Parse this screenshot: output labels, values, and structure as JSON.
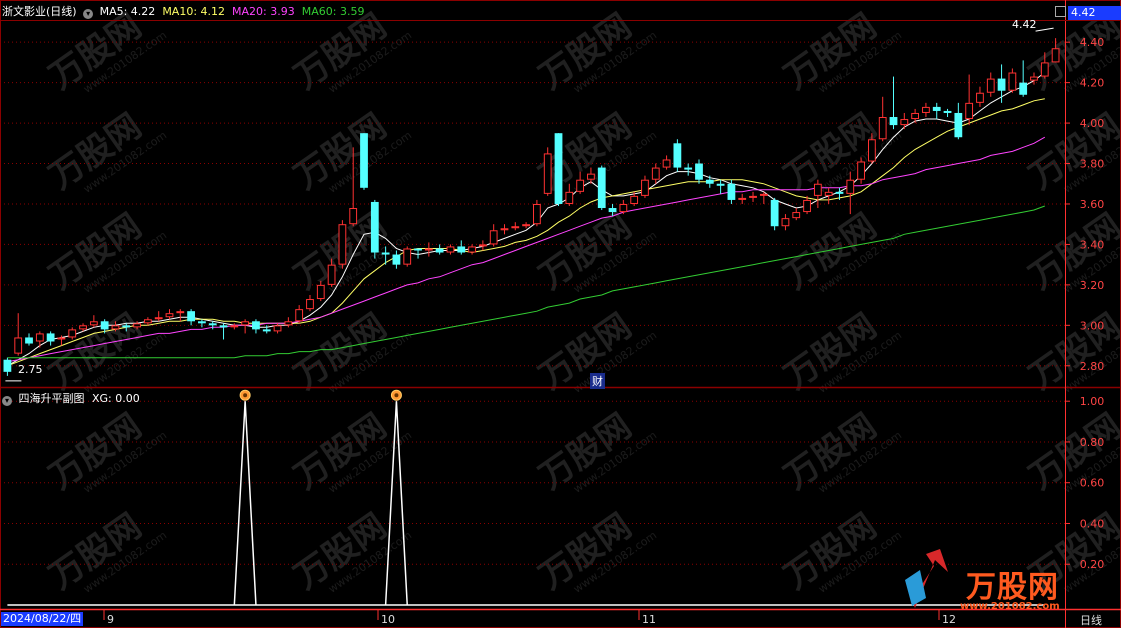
{
  "main_header": {
    "title": "浙文影业(日线)",
    "ma5_label": "MA5: 4.22",
    "ma10_label": "MA10: 4.12",
    "ma20_label": "MA20: 3.93",
    "ma60_label": "MA60: 3.59"
  },
  "sub_header": {
    "title": "四海升平副图",
    "xg_label": "XG: 0.00"
  },
  "price_axis": {
    "current_price_badge": "4.42",
    "ticks": [
      "4.40",
      "4.20",
      "4.00",
      "3.80",
      "3.60",
      "3.40",
      "3.20",
      "3.00",
      "2.80"
    ]
  },
  "indicator_axis": {
    "ticks": [
      "1.00",
      "0.80",
      "0.60",
      "0.40",
      "0.20"
    ]
  },
  "date_axis": {
    "start_date": "2024/08/22/四",
    "months": [
      "9",
      "10",
      "11",
      "12"
    ],
    "period_label": "日线"
  },
  "annotations": {
    "high_label": "4.42",
    "low_label": "2.75",
    "finance_marker": "财"
  },
  "watermark": {
    "brand": "万股网",
    "site": "www.201082.com"
  },
  "colors": {
    "up": "#ff3232",
    "down": "#54ffff",
    "ma5": "#ffffff",
    "ma10": "#ffff66",
    "ma20": "#ff44ff",
    "ma60": "#33cc33",
    "grid": "#8b0000",
    "axis_text": "#ff4444"
  },
  "chart_data": [
    {
      "type": "candlestick",
      "title": "浙文影业(日线)",
      "ylim": [
        2.7,
        4.48
      ],
      "series_note": "daily OHLC (open, close, high, low)",
      "candles": [
        [
          2.83,
          2.77,
          2.84,
          2.75
        ],
        [
          2.86,
          2.94,
          3.06,
          2.85
        ],
        [
          2.94,
          2.91,
          2.96,
          2.9
        ],
        [
          2.92,
          2.96,
          2.97,
          2.89
        ],
        [
          2.96,
          2.92,
          2.97,
          2.9
        ],
        [
          2.93,
          2.94,
          2.95,
          2.9
        ],
        [
          2.94,
          2.98,
          2.99,
          2.93
        ],
        [
          2.98,
          3.0,
          3.01,
          2.97
        ],
        [
          3.0,
          3.02,
          3.05,
          2.99
        ],
        [
          3.02,
          2.98,
          3.03,
          2.96
        ],
        [
          2.98,
          3.0,
          3.02,
          2.97
        ],
        [
          3.0,
          2.99,
          3.01,
          2.97
        ],
        [
          2.99,
          3.01,
          3.02,
          2.98
        ],
        [
          3.01,
          3.03,
          3.04,
          3.0
        ],
        [
          3.03,
          3.04,
          3.07,
          3.02
        ],
        [
          3.04,
          3.06,
          3.08,
          3.03
        ],
        [
          3.06,
          3.07,
          3.08,
          3.02
        ],
        [
          3.07,
          3.02,
          3.08,
          3.0
        ],
        [
          3.02,
          3.01,
          3.03,
          2.99
        ],
        [
          3.01,
          3.0,
          3.02,
          2.98
        ],
        [
          3.0,
          2.99,
          3.01,
          2.93
        ],
        [
          2.99,
          3.0,
          3.01,
          2.98
        ],
        [
          3.0,
          3.02,
          3.03,
          2.96
        ],
        [
          3.02,
          2.98,
          3.03,
          2.96
        ],
        [
          2.98,
          2.97,
          3.0,
          2.96
        ],
        [
          2.97,
          3.0,
          3.01,
          2.96
        ],
        [
          3.0,
          3.02,
          3.04,
          2.99
        ],
        [
          3.02,
          3.08,
          3.1,
          3.01
        ],
        [
          3.08,
          3.13,
          3.15,
          3.07
        ],
        [
          3.13,
          3.2,
          3.22,
          3.12
        ],
        [
          3.2,
          3.3,
          3.33,
          3.19
        ],
        [
          3.3,
          3.5,
          3.52,
          3.28
        ],
        [
          3.5,
          3.58,
          3.88,
          3.49
        ],
        [
          3.95,
          3.68,
          3.95,
          3.67
        ],
        [
          3.61,
          3.36,
          3.62,
          3.33
        ],
        [
          3.36,
          3.35,
          3.39,
          3.3
        ],
        [
          3.35,
          3.3,
          3.37,
          3.28
        ],
        [
          3.3,
          3.38,
          3.39,
          3.29
        ],
        [
          3.38,
          3.37,
          3.38,
          3.33
        ],
        [
          3.37,
          3.38,
          3.41,
          3.34
        ],
        [
          3.38,
          3.36,
          3.4,
          3.35
        ],
        [
          3.36,
          3.39,
          3.4,
          3.35
        ],
        [
          3.39,
          3.36,
          3.42,
          3.35
        ],
        [
          3.36,
          3.39,
          3.4,
          3.35
        ],
        [
          3.39,
          3.4,
          3.42,
          3.37
        ],
        [
          3.4,
          3.47,
          3.5,
          3.39
        ],
        [
          3.47,
          3.48,
          3.5,
          3.45
        ],
        [
          3.48,
          3.49,
          3.51,
          3.47
        ],
        [
          3.49,
          3.5,
          3.51,
          3.48
        ],
        [
          3.5,
          3.6,
          3.62,
          3.49
        ],
        [
          3.65,
          3.85,
          3.88,
          3.64
        ],
        [
          3.95,
          3.6,
          3.95,
          3.59
        ],
        [
          3.6,
          3.66,
          3.7,
          3.59
        ],
        [
          3.66,
          3.72,
          3.76,
          3.65
        ],
        [
          3.72,
          3.75,
          3.78,
          3.7
        ],
        [
          3.78,
          3.58,
          3.79,
          3.57
        ],
        [
          3.58,
          3.56,
          3.6,
          3.54
        ],
        [
          3.56,
          3.6,
          3.62,
          3.55
        ],
        [
          3.6,
          3.64,
          3.66,
          3.59
        ],
        [
          3.64,
          3.72,
          3.74,
          3.63
        ],
        [
          3.72,
          3.78,
          3.8,
          3.7
        ],
        [
          3.78,
          3.82,
          3.84,
          3.77
        ],
        [
          3.9,
          3.78,
          3.92,
          3.76
        ],
        [
          3.78,
          3.77,
          3.8,
          3.74
        ],
        [
          3.8,
          3.72,
          3.82,
          3.7
        ],
        [
          3.72,
          3.7,
          3.74,
          3.68
        ],
        [
          3.7,
          3.69,
          3.72,
          3.65
        ],
        [
          3.7,
          3.62,
          3.72,
          3.6
        ],
        [
          3.62,
          3.63,
          3.65,
          3.6
        ],
        [
          3.63,
          3.64,
          3.66,
          3.61
        ],
        [
          3.64,
          3.65,
          3.66,
          3.6
        ],
        [
          3.62,
          3.49,
          3.63,
          3.47
        ],
        [
          3.49,
          3.53,
          3.55,
          3.47
        ],
        [
          3.53,
          3.56,
          3.58,
          3.52
        ],
        [
          3.56,
          3.62,
          3.64,
          3.55
        ],
        [
          3.64,
          3.7,
          3.72,
          3.58
        ],
        [
          3.64,
          3.66,
          3.68,
          3.6
        ],
        [
          3.66,
          3.65,
          3.68,
          3.62
        ],
        [
          3.65,
          3.72,
          3.76,
          3.55
        ],
        [
          3.72,
          3.81,
          3.83,
          3.7
        ],
        [
          3.81,
          3.92,
          3.95,
          3.8
        ],
        [
          3.92,
          4.03,
          4.13,
          3.91
        ],
        [
          4.03,
          3.99,
          4.23,
          3.97
        ],
        [
          3.99,
          4.02,
          4.05,
          3.97
        ],
        [
          4.02,
          4.05,
          4.07,
          4.0
        ],
        [
          4.05,
          4.08,
          4.1,
          4.03
        ],
        [
          4.08,
          4.06,
          4.1,
          4.02
        ],
        [
          4.06,
          4.05,
          4.07,
          4.03
        ],
        [
          4.05,
          3.93,
          4.1,
          3.92
        ],
        [
          4.02,
          4.1,
          4.24,
          3.99
        ],
        [
          4.1,
          4.15,
          4.18,
          4.08
        ],
        [
          4.15,
          4.22,
          4.25,
          4.13
        ],
        [
          4.22,
          4.16,
          4.29,
          4.1
        ],
        [
          4.16,
          4.25,
          4.27,
          4.15
        ],
        [
          4.2,
          4.14,
          4.31,
          4.13
        ],
        [
          4.21,
          4.23,
          4.25,
          4.19
        ],
        [
          4.23,
          4.3,
          4.35,
          4.22
        ],
        [
          4.3,
          4.37,
          4.42,
          4.3
        ]
      ],
      "ma": {
        "MA5": [
          2.8,
          2.83,
          2.86,
          2.9,
          2.93,
          2.94,
          2.95,
          2.97,
          2.99,
          3.0,
          3.0,
          3.01,
          3.01,
          3.02,
          3.02,
          3.03,
          3.04,
          3.04,
          3.03,
          3.02,
          3.01,
          3.0,
          3.0,
          2.99,
          2.99,
          3.0,
          3.0,
          3.02,
          3.05,
          3.09,
          3.15,
          3.24,
          3.35,
          3.45,
          3.46,
          3.43,
          3.38,
          3.36,
          3.35,
          3.36,
          3.37,
          3.37,
          3.37,
          3.38,
          3.39,
          3.41,
          3.43,
          3.45,
          3.47,
          3.51,
          3.58,
          3.6,
          3.63,
          3.68,
          3.71,
          3.67,
          3.64,
          3.64,
          3.65,
          3.66,
          3.7,
          3.74,
          3.76,
          3.76,
          3.75,
          3.73,
          3.72,
          3.7,
          3.69,
          3.68,
          3.66,
          3.62,
          3.6,
          3.58,
          3.59,
          3.62,
          3.64,
          3.66,
          3.69,
          3.74,
          3.8,
          3.87,
          3.93,
          3.98,
          4.01,
          4.02,
          4.02,
          4.01,
          4.0,
          4.02,
          4.06,
          4.1,
          4.13,
          4.16,
          4.18,
          4.21,
          4.25
        ],
        "MA10": [
          2.8,
          2.82,
          2.84,
          2.86,
          2.88,
          2.9,
          2.92,
          2.94,
          2.96,
          2.97,
          2.98,
          2.99,
          3.0,
          3.0,
          3.01,
          3.02,
          3.02,
          3.03,
          3.03,
          3.03,
          3.02,
          3.02,
          3.01,
          3.01,
          3.01,
          3.01,
          3.01,
          3.01,
          3.02,
          3.04,
          3.06,
          3.11,
          3.17,
          3.23,
          3.27,
          3.31,
          3.34,
          3.37,
          3.38,
          3.38,
          3.38,
          3.38,
          3.37,
          3.36,
          3.37,
          3.38,
          3.39,
          3.41,
          3.42,
          3.44,
          3.47,
          3.51,
          3.54,
          3.58,
          3.61,
          3.63,
          3.64,
          3.65,
          3.66,
          3.67,
          3.68,
          3.69,
          3.7,
          3.71,
          3.71,
          3.71,
          3.72,
          3.72,
          3.72,
          3.71,
          3.7,
          3.68,
          3.66,
          3.64,
          3.63,
          3.62,
          3.62,
          3.63,
          3.64,
          3.66,
          3.7,
          3.74,
          3.78,
          3.83,
          3.87,
          3.9,
          3.93,
          3.96,
          3.98,
          4.0,
          4.02,
          4.04,
          4.06,
          4.07,
          4.09,
          4.11,
          4.12
        ],
        "MA20": [
          2.82,
          2.83,
          2.84,
          2.85,
          2.86,
          2.87,
          2.88,
          2.89,
          2.9,
          2.91,
          2.92,
          2.93,
          2.94,
          2.95,
          2.96,
          2.96,
          2.97,
          2.98,
          2.98,
          2.99,
          2.99,
          3.0,
          3.0,
          3.0,
          3.01,
          3.01,
          3.01,
          3.02,
          3.03,
          3.04,
          3.06,
          3.08,
          3.1,
          3.12,
          3.14,
          3.16,
          3.18,
          3.2,
          3.21,
          3.23,
          3.24,
          3.26,
          3.28,
          3.3,
          3.31,
          3.33,
          3.35,
          3.37,
          3.39,
          3.41,
          3.43,
          3.45,
          3.47,
          3.49,
          3.51,
          3.53,
          3.54,
          3.56,
          3.57,
          3.58,
          3.59,
          3.6,
          3.61,
          3.62,
          3.63,
          3.64,
          3.65,
          3.66,
          3.66,
          3.67,
          3.67,
          3.67,
          3.67,
          3.67,
          3.67,
          3.68,
          3.68,
          3.68,
          3.69,
          3.69,
          3.7,
          3.72,
          3.73,
          3.74,
          3.75,
          3.77,
          3.78,
          3.79,
          3.8,
          3.81,
          3.82,
          3.84,
          3.85,
          3.86,
          3.88,
          3.9,
          3.93
        ],
        "MA60": [
          2.84,
          2.84,
          2.84,
          2.84,
          2.84,
          2.84,
          2.84,
          2.84,
          2.84,
          2.84,
          2.84,
          2.84,
          2.84,
          2.84,
          2.84,
          2.84,
          2.84,
          2.84,
          2.84,
          2.84,
          2.84,
          2.84,
          2.85,
          2.85,
          2.85,
          2.86,
          2.86,
          2.87,
          2.87,
          2.88,
          2.88,
          2.89,
          2.9,
          2.91,
          2.92,
          2.93,
          2.94,
          2.95,
          2.96,
          2.97,
          2.98,
          2.99,
          3.0,
          3.01,
          3.02,
          3.03,
          3.04,
          3.05,
          3.06,
          3.07,
          3.09,
          3.1,
          3.11,
          3.13,
          3.14,
          3.15,
          3.17,
          3.18,
          3.19,
          3.2,
          3.21,
          3.22,
          3.23,
          3.24,
          3.25,
          3.26,
          3.27,
          3.28,
          3.29,
          3.3,
          3.31,
          3.32,
          3.33,
          3.34,
          3.35,
          3.36,
          3.37,
          3.38,
          3.39,
          3.4,
          3.41,
          3.42,
          3.43,
          3.45,
          3.46,
          3.47,
          3.48,
          3.49,
          3.5,
          3.51,
          3.52,
          3.53,
          3.54,
          3.55,
          3.56,
          3.57,
          3.59
        ]
      }
    },
    {
      "type": "line",
      "title": "四海升平副图",
      "series_name": "XG",
      "ylim": [
        0,
        1.05
      ],
      "values": [
        0,
        0,
        0,
        0,
        0,
        0,
        0,
        0,
        0,
        0,
        0,
        0,
        0,
        0,
        0,
        0,
        0,
        0,
        0,
        0,
        0,
        0,
        0,
        0,
        0,
        0,
        0,
        0,
        0,
        0,
        0,
        0,
        0,
        0,
        0,
        0,
        0,
        0,
        0,
        0,
        0,
        0,
        0,
        0,
        0,
        0,
        0,
        0,
        0,
        0,
        0,
        0,
        0,
        0,
        0,
        0,
        0,
        0,
        0,
        0,
        0,
        0,
        0,
        0,
        0,
        0,
        0,
        0,
        0,
        0,
        0,
        0,
        0,
        0,
        0,
        0,
        0,
        0,
        0,
        0,
        0,
        0,
        0,
        0,
        0,
        0,
        0,
        0,
        0,
        0,
        0,
        0,
        0,
        0,
        0,
        0,
        0
      ],
      "signal_points": [
        {
          "index": 22,
          "value": 1.0
        },
        {
          "index": 36,
          "value": 1.0
        }
      ]
    }
  ]
}
